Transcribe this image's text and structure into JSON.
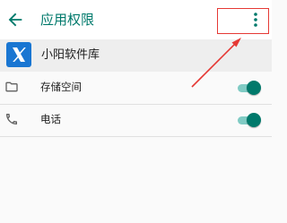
{
  "toolbar": {
    "title": "应用权限",
    "back_icon": "arrow-back-icon",
    "more_icon": "more-vert-icon",
    "accent_color": "#00796b"
  },
  "app": {
    "name": "小阳软件库",
    "icon": "x-logo-icon",
    "icon_color": "#1976d2"
  },
  "permissions": [
    {
      "label": "存储空间",
      "icon": "folder-icon",
      "enabled": true
    },
    {
      "label": "电话",
      "icon": "phone-icon",
      "enabled": true
    }
  ],
  "annotation": {
    "color": "#e53935",
    "target": "more-options-button"
  }
}
